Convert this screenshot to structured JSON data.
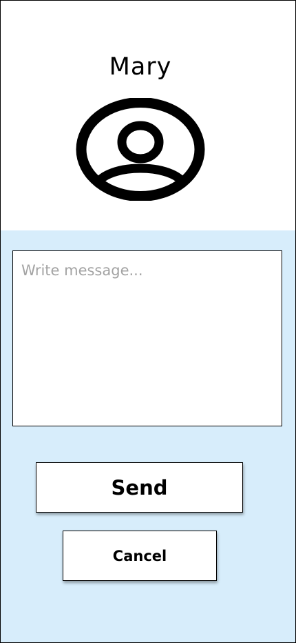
{
  "contact": {
    "name": "Mary",
    "avatar_icon": "user-circle-icon"
  },
  "composer": {
    "placeholder": "Write message...",
    "value": ""
  },
  "actions": {
    "send_label": "Send",
    "cancel_label": "Cancel"
  },
  "colors": {
    "composer_background": "#d7edfb",
    "header_background": "#ffffff",
    "placeholder_text": "#a3a3a3"
  }
}
